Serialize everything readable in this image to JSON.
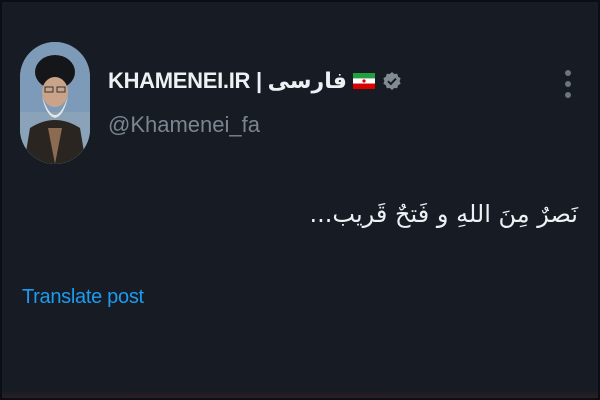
{
  "author": {
    "display_name": "KHAMENEI.IR | فارسی",
    "handle": "@Khamenei_fa",
    "flag_icon": "iran-flag-icon",
    "verified_icon": "verified-badge-icon"
  },
  "post": {
    "text": "نَصرٌ مِنَ اللهِ و فَتحٌ قَریب..."
  },
  "actions": {
    "translate_label": "Translate post",
    "more_icon": "more-vertical-icon"
  },
  "colors": {
    "background": "#161b24",
    "link": "#1d9bf0",
    "handle": "#7b8590"
  }
}
